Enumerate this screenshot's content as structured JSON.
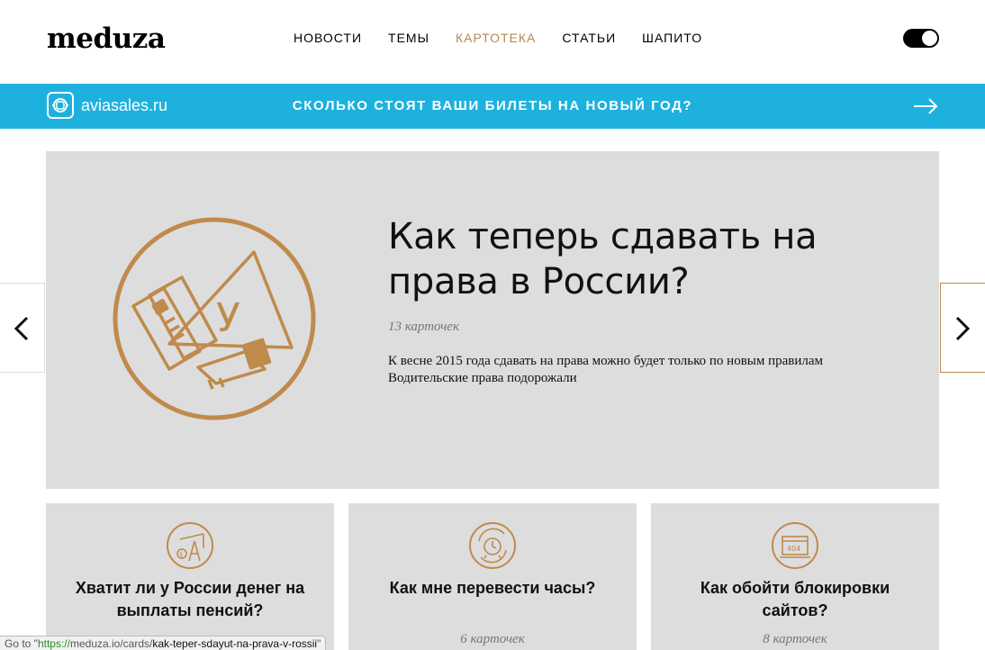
{
  "header": {
    "logo": "meduza",
    "nav": [
      {
        "label": "НОВОСТИ",
        "active": false
      },
      {
        "label": "ТЕМЫ",
        "active": false
      },
      {
        "label": "КАРТОТЕКА",
        "active": true
      },
      {
        "label": "СТАТЬИ",
        "active": false
      },
      {
        "label": "ШАПИТО",
        "active": false
      }
    ],
    "theme_toggle": "dark-mode-toggle"
  },
  "banner": {
    "brand": "aviasales.ru",
    "text": "СКОЛЬКО СТОЯТ ВАШИ БИЛЕТЫ НА НОВЫЙ ГОД?",
    "background": "#1eb1de",
    "arrow_icon": "arrow-right-icon"
  },
  "hero": {
    "title": "Как теперь сдавать на права в России?",
    "count": "13 карточек",
    "description": [
      "К весне 2015 года сдавать на права можно будет только по новым правилам",
      "Водительские права подорожали"
    ],
    "icon": "driving-license-icon"
  },
  "carousel": {
    "prev_icon": "chevron-left-icon",
    "next_icon": "chevron-right-icon"
  },
  "cards": [
    {
      "title": "Хватит ли у России денег на выплаты пенсий?",
      "count": "",
      "icon": "oil-pump-icon"
    },
    {
      "title": "Как мне перевести часы?",
      "count": "6 карточек",
      "icon": "clock-icon"
    },
    {
      "title": "Как обойти блокировки сайтов?",
      "count": "8 карточек",
      "icon": "browser-404-icon"
    }
  ],
  "status_bar": {
    "prefix": "Go to \"",
    "protocol": "https://",
    "host": "meduza.io/cards/",
    "path": "kak-teper-sdayut-na-prava-v-rossii",
    "suffix": "\""
  },
  "colors": {
    "accent": "#b48a4e",
    "card_bg": "#dddddd"
  }
}
